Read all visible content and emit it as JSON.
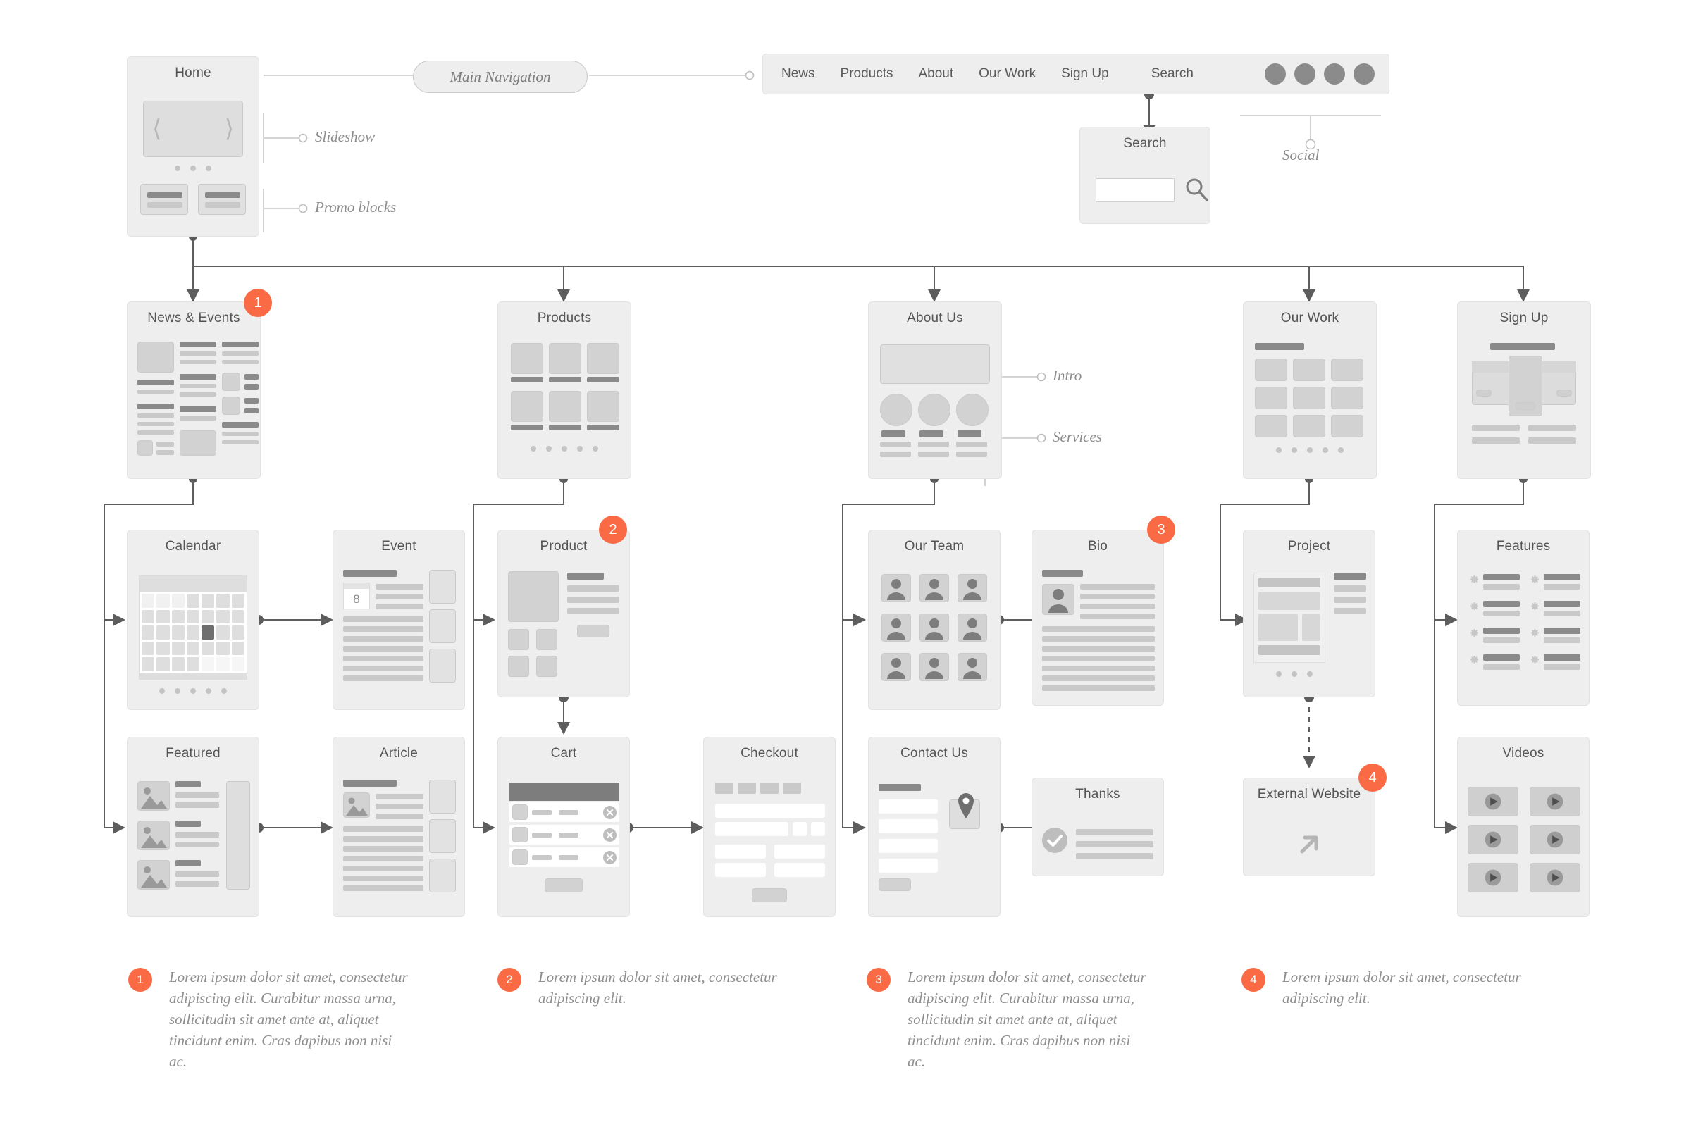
{
  "home": {
    "title": "Home",
    "slideshow_label": "Slideshow",
    "promo_label": "Promo blocks",
    "prev_icon": "chevron-left-icon",
    "next_icon": "chevron-right-icon"
  },
  "nav_pill": {
    "label": "Main Navigation"
  },
  "navbar": {
    "items": [
      "News",
      "Products",
      "About",
      "Our Work",
      "Sign Up",
      "Search"
    ],
    "social_label": "Social",
    "social_count": 4
  },
  "search_card": {
    "title": "Search",
    "input_value": "",
    "search_icon": "magnifier-icon"
  },
  "level2": [
    {
      "title": "News & Events",
      "marker": "1"
    },
    {
      "title": "Products",
      "marker": null
    },
    {
      "title": "About Us",
      "marker": null,
      "callouts": [
        "Intro",
        "Services"
      ]
    },
    {
      "title": "Our Work",
      "marker": null
    },
    {
      "title": "Sign Up",
      "marker": null
    }
  ],
  "level3": [
    {
      "title": "Calendar",
      "marker": null,
      "selected_day": ""
    },
    {
      "title": "Event",
      "marker": null,
      "date_badge": "8"
    },
    {
      "title": "Product",
      "marker": "2"
    },
    {
      "title": "Our Team",
      "marker": null
    },
    {
      "title": "Bio",
      "marker": "3"
    },
    {
      "title": "Project",
      "marker": null
    },
    {
      "title": "Features",
      "marker": null
    }
  ],
  "level4": [
    {
      "title": "Featured",
      "marker": null
    },
    {
      "title": "Article",
      "marker": null
    },
    {
      "title": "Cart",
      "marker": null
    },
    {
      "title": "Checkout",
      "marker": null
    },
    {
      "title": "Contact Us",
      "marker": null
    },
    {
      "title": "Thanks",
      "marker": null
    },
    {
      "title": "External Website",
      "marker": "4",
      "icon": "arrow-up-right-icon"
    },
    {
      "title": "Videos",
      "marker": null
    }
  ],
  "footnotes": [
    {
      "num": "1",
      "text": "Lorem ipsum dolor sit amet, consectetur adipiscing elit. Curabitur massa urna, sollicitudin sit amet ante at, aliquet tincidunt enim. Cras dapibus non nisi ac."
    },
    {
      "num": "2",
      "text": "Lorem ipsum dolor sit amet, consectetur adipiscing elit."
    },
    {
      "num": "3",
      "text": "Lorem ipsum dolor sit amet, consectetur adipiscing elit. Curabitur massa urna, sollicitudin sit amet ante at, aliquet tincidunt enim. Cras dapibus non nisi ac."
    },
    {
      "num": "4",
      "text": "Lorem ipsum dolor sit amet, consectetur adipiscing elit."
    }
  ],
  "colors": {
    "accent": "#f96a45",
    "card_bg": "#eeeeee",
    "line": "#6f6f6f",
    "text": "#5a5a5a"
  }
}
